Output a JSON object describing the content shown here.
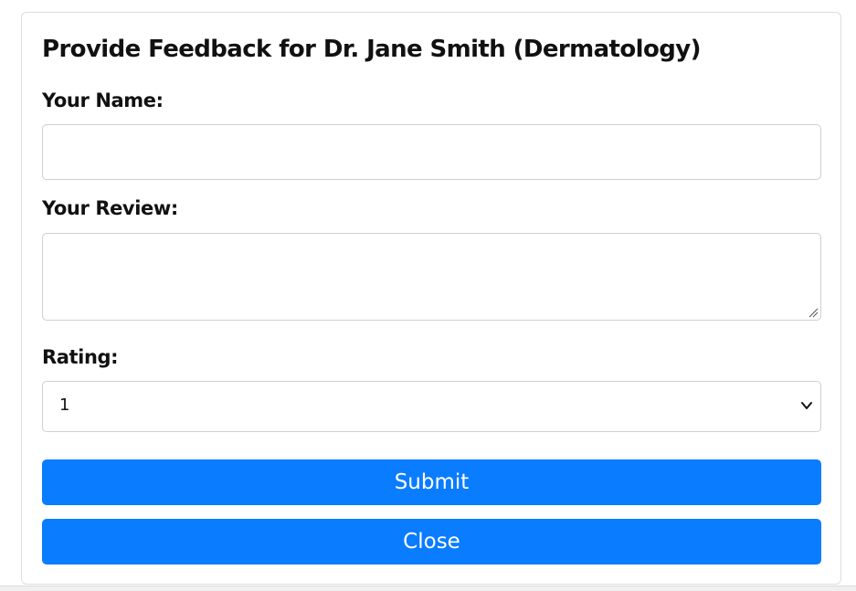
{
  "form": {
    "title": "Provide Feedback for Dr. Jane Smith (Dermatology)",
    "name_label": "Your Name:",
    "name_value": "",
    "review_label": "Your Review:",
    "review_value": "",
    "rating_label": "Rating:",
    "rating_value": "1",
    "submit_label": "Submit",
    "close_label": "Close"
  },
  "colors": {
    "button_bg": "#0a7cff",
    "button_text": "#ffffff",
    "border": "#cfcfcf"
  },
  "icons": {
    "select_chevron": "chevron-down-icon",
    "textarea_resize": "resize-handle-icon"
  }
}
